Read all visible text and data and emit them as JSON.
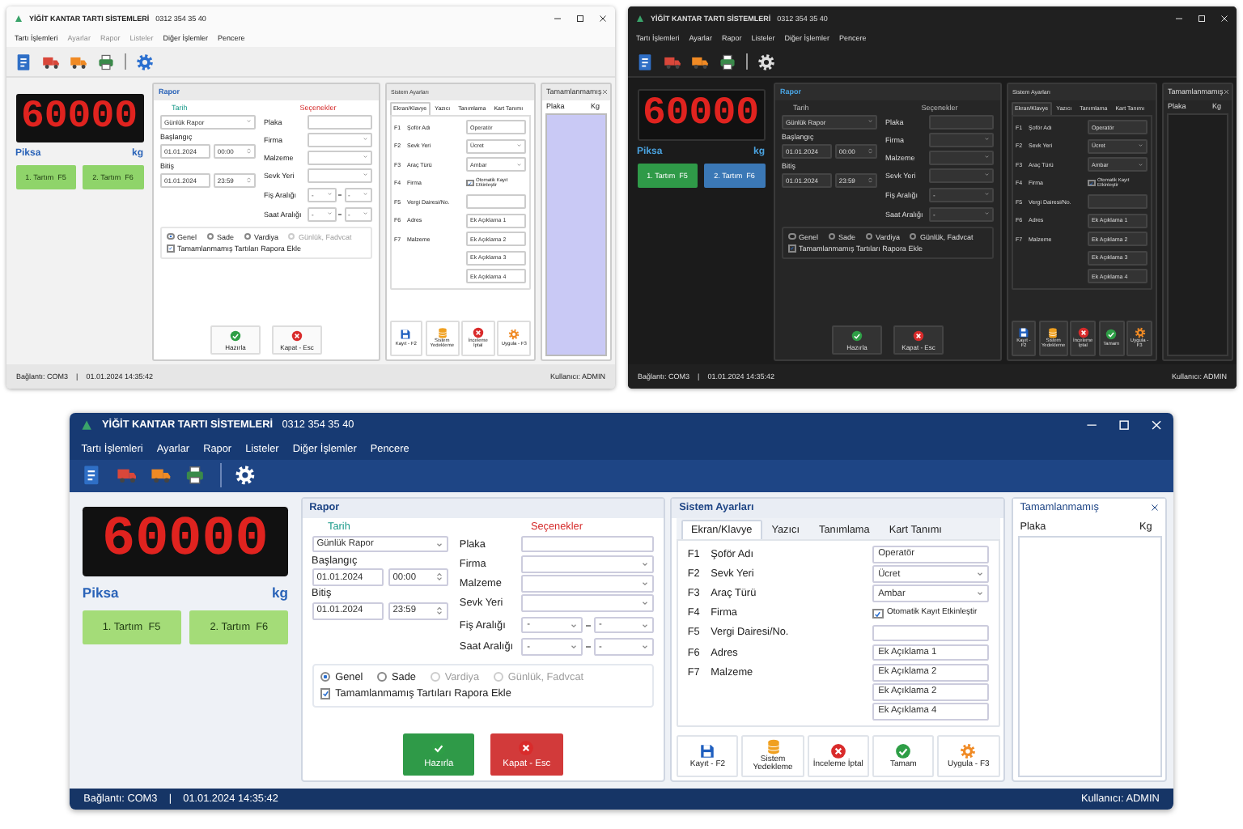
{
  "windows": [
    {
      "kind": "light",
      "title": "YİĞİT KANTAR TARTI SİSTEMLERİ",
      "phone": "0312 354 35 40",
      "menu": [
        {
          "label": "Tartı İşlemleri",
          "disabled": false
        },
        {
          "label": "Ayarlar",
          "disabled": true
        },
        {
          "label": "Rapor",
          "disabled": true
        },
        {
          "label": "Listeler",
          "disabled": true
        },
        {
          "label": "Diğer İşlemler",
          "disabled": false
        },
        {
          "label": "Pencere",
          "disabled": false
        }
      ],
      "scale": {
        "reading": "60000",
        "label": "Piksa",
        "unit": "kg",
        "buttons": [
          "1. Tartım  F5",
          "2. Tartım  F6"
        ]
      },
      "report": {
        "title": "Rapor",
        "date_heading": "Tarih",
        "period": "Günlük Rapor",
        "start_label": "Başlangıç",
        "start_date": "01.01.2024",
        "start_time": "00:00",
        "end_label": "Bitiş",
        "end_date": "01.01.2024",
        "end_time": "23:59",
        "options_heading": "Seçenekler",
        "fields": [
          {
            "label": "Plaka",
            "kind": "text"
          },
          {
            "label": "Firma",
            "kind": "select"
          },
          {
            "label": "Malzeme",
            "kind": "select"
          },
          {
            "label": "Sevk Yeri",
            "kind": "select"
          },
          {
            "label": "Fiş Aralığı",
            "kind": "range",
            "values": [
              "-",
              "-"
            ]
          },
          {
            "label": "Saat Aralığı",
            "kind": "range",
            "values": [
              "-",
              "-"
            ]
          }
        ],
        "modes": [
          {
            "label": "Genel",
            "selected": true,
            "disabled": false
          },
          {
            "label": "Sade",
            "selected": false,
            "disabled": false
          },
          {
            "label": "Vardiya",
            "selected": false,
            "disabled": false
          },
          {
            "label": "Günlük, Fadvcat",
            "selected": false,
            "disabled": true
          }
        ],
        "include": {
          "label": "Tamamlanmamış Tartıları Rapora Ekle",
          "checked": true
        },
        "actions": [
          {
            "label": "Hazırla",
            "kind": "ok"
          },
          {
            "label": "Kapat - Esc",
            "kind": "cancel"
          }
        ]
      },
      "settings": {
        "title": "Sistem Ayarları",
        "tabs": [
          {
            "label": "Ekran/Klavye",
            "selected": true
          },
          {
            "label": "Yazıcı",
            "selected": false
          },
          {
            "label": "Tanımlama",
            "selected": false
          },
          {
            "label": "Kart Tanımı",
            "selected": false
          }
        ],
        "rows": [
          {
            "key": "F1",
            "label": "Şoför Adı",
            "kind": "text",
            "value": "Operatör"
          },
          {
            "key": "F2",
            "label": "Sevk Yeri",
            "kind": "select",
            "value": "Ücret"
          },
          {
            "key": "F3",
            "label": "Araç Türü",
            "kind": "select",
            "value": "Ambar"
          },
          {
            "key": "F4",
            "label": "Firma",
            "kind": "check",
            "checked": true,
            "value": "Otomatik Kayıt Etkinleştir"
          },
          {
            "key": "F5",
            "label": "Vergi Dairesi/No.",
            "kind": "text"
          },
          {
            "key": "F6",
            "label": "Adres",
            "kind": "text",
            "value": "Ek Açıklama 1"
          },
          {
            "key": "F7",
            "label": "Malzeme",
            "kind": "text",
            "value": "Ek Açıklama 2"
          },
          {
            "kind": "text",
            "value": "Ek Açıklama 3"
          },
          {
            "kind": "text",
            "value": "Ek Açıklama 4"
          }
        ],
        "buttons": [
          {
            "label": "Kayıt - F2",
            "kind": "save"
          },
          {
            "label": "Sistem Yedekleme",
            "kind": "backup"
          },
          {
            "label": "İnceleme İptal",
            "kind": "cancel"
          },
          {
            "label": "Uygula - F3",
            "kind": "apply"
          }
        ]
      },
      "pending": {
        "title": "Tamamlanmamış",
        "columns": [
          "Plaka",
          "Kg"
        ]
      },
      "status": {
        "connection": "Bağlantı: COM3",
        "separator": "|",
        "datetime": "01.01.2024 14:35:42",
        "user": "Kullanıcı: ADMIN"
      }
    },
    {
      "kind": "dark",
      "title": "YİĞİT KANTAR TARTI SİSTEMLERİ",
      "phone": "0312 354 35 40",
      "menu": [
        {
          "label": "Tartı İşlemleri",
          "disabled": false
        },
        {
          "label": "Ayarlar",
          "disabled": false
        },
        {
          "label": "Rapor",
          "disabled": false
        },
        {
          "label": "Listeler",
          "disabled": false
        },
        {
          "label": "Diğer İşlemler",
          "disabled": false
        },
        {
          "label": "Pencere",
          "disabled": false
        }
      ],
      "scale": {
        "reading": "60000",
        "label": "Piksa",
        "unit": "kg",
        "buttons": [
          "1. Tartım  F5",
          "2. Tartım  F6"
        ]
      },
      "report": {
        "title": "Rapor",
        "date_heading": "Tarih",
        "period": "Günlük Rapor",
        "start_label": "Başlangıç",
        "start_date": "01.01.2024",
        "start_time": "00:00",
        "end_label": "Bitiş",
        "end_date": "01.01.2024",
        "end_time": "23:59",
        "options_heading": "Seçenekler",
        "fields": [
          {
            "label": "Plaka",
            "kind": "text"
          },
          {
            "label": "Firma",
            "kind": "select"
          },
          {
            "label": "Malzeme",
            "kind": "select"
          },
          {
            "label": "Sevk Yeri",
            "kind": "select"
          },
          {
            "label": "Fiş Aralığı",
            "kind": "range",
            "values": [
              "-"
            ]
          },
          {
            "label": "Saat Aralığı",
            "kind": "range",
            "values": [
              "-"
            ]
          }
        ],
        "modes": [
          {
            "label": "Genel",
            "selected": false,
            "disabled": false
          },
          {
            "label": "Sade",
            "selected": false,
            "disabled": false
          },
          {
            "label": "Vardiya",
            "selected": false,
            "disabled": false
          },
          {
            "label": "Günlük, Fadvcat",
            "selected": false,
            "disabled": false
          }
        ],
        "include": {
          "label": "Tamamlanmamış Tartıları Rapora Ekle",
          "checked": true
        },
        "actions": [
          {
            "label": "Hazırla",
            "kind": "ok"
          },
          {
            "label": "Kapat - Esc",
            "kind": "cancel"
          }
        ]
      },
      "settings": {
        "title": "Sistem Ayarları",
        "tabs": [
          {
            "label": "Ekran/Klavye",
            "selected": true
          },
          {
            "label": "Yazıcı",
            "selected": false
          },
          {
            "label": "Tanımlama",
            "selected": false
          },
          {
            "label": "Kart Tanımı",
            "selected": false
          }
        ],
        "rows": [
          {
            "key": "F1",
            "label": "Şoför Adı",
            "kind": "text",
            "value": "Operatör"
          },
          {
            "key": "F2",
            "label": "Sevk Yeri",
            "kind": "select",
            "value": "Ücret"
          },
          {
            "key": "F3",
            "label": "Araç Türü",
            "kind": "select",
            "value": "Ambar"
          },
          {
            "key": "F4",
            "label": "Firma",
            "kind": "check",
            "checked": true,
            "value": "Otomatik Kayıt Etkinleştir"
          },
          {
            "key": "F5",
            "label": "Vergi Dairesi/No.",
            "kind": "text"
          },
          {
            "key": "F6",
            "label": "Adres",
            "kind": "text",
            "value": "Ek Açıklama 1"
          },
          {
            "key": "F7",
            "label": "Malzeme",
            "kind": "text",
            "value": "Ek Açıklama 2"
          },
          {
            "kind": "text",
            "value": "Ek Açıklama 3"
          },
          {
            "kind": "text",
            "value": "Ek Açıklama 4"
          }
        ],
        "buttons": [
          {
            "label": "Kayıt - F2",
            "kind": "save"
          },
          {
            "label": "Sistem Yedekleme",
            "kind": "backup"
          },
          {
            "label": "İnceleme İptal",
            "kind": "cancel"
          },
          {
            "label": "Tamam",
            "kind": "ok"
          },
          {
            "label": "Uygula - F3",
            "kind": "apply"
          }
        ]
      },
      "pending": {
        "title": "Tamamlanmamış",
        "columns": [
          "Plaka",
          "Kg"
        ]
      },
      "status": {
        "connection": "Bağlantı: COM3",
        "separator": "|",
        "datetime": "01.01.2024 14:35:42",
        "user": "Kullanıcı: ADMIN"
      }
    },
    {
      "kind": "blue",
      "title": "YİĞİT KANTAR TARTI SİSTEMLERİ",
      "phone": "0312 354 35 40",
      "menu": [
        {
          "label": "Tartı İşlemleri",
          "disabled": false
        },
        {
          "label": "Ayarlar",
          "disabled": false
        },
        {
          "label": "Rapor",
          "disabled": false
        },
        {
          "label": "Listeler",
          "disabled": false
        },
        {
          "label": "Diğer İşlemler",
          "disabled": false
        },
        {
          "label": "Pencere",
          "disabled": false
        }
      ],
      "scale": {
        "reading": "60000",
        "label": "Piksa",
        "unit": "kg",
        "buttons": [
          "1. Tartım  F5",
          "2. Tartım  F6"
        ]
      },
      "report": {
        "title": "Rapor",
        "date_heading": "Tarih",
        "period": "Günlük Rapor",
        "start_label": "Başlangıç",
        "start_date": "01.01.2024",
        "start_time": "00:00",
        "end_label": "Bitiş",
        "end_date": "01.01.2024",
        "end_time": "23:59",
        "options_heading": "Seçenekler",
        "fields": [
          {
            "label": "Plaka",
            "kind": "text"
          },
          {
            "label": "Firma",
            "kind": "select"
          },
          {
            "label": "Malzeme",
            "kind": "select"
          },
          {
            "label": "Sevk Yeri",
            "kind": "select"
          },
          {
            "label": "Fiş Aralığı",
            "kind": "range",
            "values": [
              "-",
              "-"
            ]
          },
          {
            "label": "Saat Aralığı",
            "kind": "range",
            "values": [
              "-",
              "-"
            ]
          }
        ],
        "modes": [
          {
            "label": "Genel",
            "selected": true,
            "disabled": false
          },
          {
            "label": "Sade",
            "selected": false,
            "disabled": false
          },
          {
            "label": "Vardiya",
            "selected": false,
            "disabled": true
          },
          {
            "label": "Günlük, Fadvcat",
            "selected": false,
            "disabled": true
          }
        ],
        "include": {
          "label": "Tamamlanmamış Tartıları Rapora Ekle",
          "checked": true
        },
        "actions": [
          {
            "label": "Hazırla",
            "kind": "ok"
          },
          {
            "label": "Kapat - Esc",
            "kind": "cancel"
          }
        ]
      },
      "settings": {
        "title": "Sistem Ayarları",
        "tabs": [
          {
            "label": "Ekran/Klavye",
            "selected": true
          },
          {
            "label": "Yazıcı",
            "selected": false
          },
          {
            "label": "Tanımlama",
            "selected": false
          },
          {
            "label": "Kart Tanımı",
            "selected": false
          }
        ],
        "rows": [
          {
            "key": "F1",
            "label": "Şoför Adı",
            "kind": "text",
            "value": "Operatör"
          },
          {
            "key": "F2",
            "label": "Sevk Yeri",
            "kind": "select",
            "value": "Ücret"
          },
          {
            "key": "F3",
            "label": "Araç Türü",
            "kind": "select",
            "value": "Ambar"
          },
          {
            "key": "F4",
            "label": "Firma",
            "kind": "check",
            "checked": true,
            "value": "Otomatik Kayıt Etkinleştir"
          },
          {
            "key": "F5",
            "label": "Vergi Dairesi/No.",
            "kind": "text"
          },
          {
            "key": "F6",
            "label": "Adres",
            "kind": "text",
            "value": "Ek Açıklama 1"
          },
          {
            "key": "F7",
            "label": "Malzeme",
            "kind": "text",
            "value": "Ek Açıklama 2"
          },
          {
            "kind": "text",
            "value": "Ek Açıklama 2"
          },
          {
            "kind": "text",
            "value": "Ek Açıklama 4"
          }
        ],
        "buttons": [
          {
            "label": "Kayıt - F2",
            "kind": "save"
          },
          {
            "label": "Sistem Yedekleme",
            "kind": "backup"
          },
          {
            "label": "İnceleme İptal",
            "kind": "cancel"
          },
          {
            "label": "Tamam",
            "kind": "ok"
          },
          {
            "label": "Uygula - F3",
            "kind": "apply"
          }
        ]
      },
      "pending": {
        "title": "Tamamlanmamış",
        "columns": [
          "Plaka",
          "Kg"
        ]
      },
      "status": {
        "connection": "Bağlantı: COM3",
        "separator": "|",
        "datetime": "01.01.2024 14:35:42",
        "user": "Kullanıcı: ADMIN"
      }
    }
  ]
}
